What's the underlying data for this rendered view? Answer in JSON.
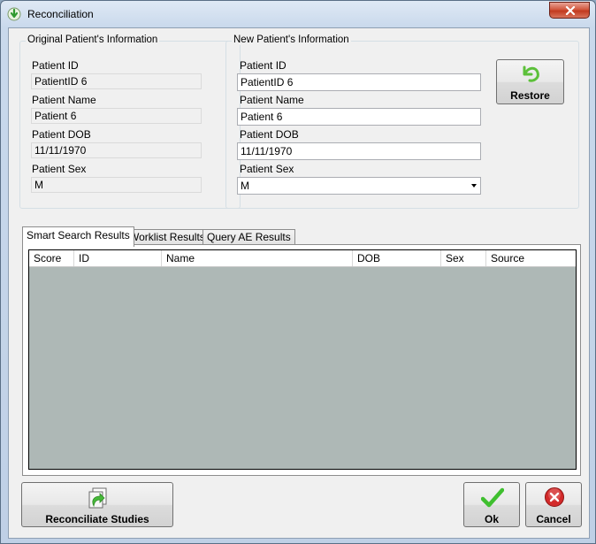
{
  "window": {
    "title": "Reconciliation",
    "close_glyph": "✕"
  },
  "original": {
    "group_title": "Original Patient's Information",
    "patient_id_label": "Patient ID",
    "patient_id": "PatientID 6",
    "patient_name_label": "Patient Name",
    "patient_name": "Patient 6",
    "patient_dob_label": "Patient DOB",
    "patient_dob": "11/11/1970",
    "patient_sex_label": "Patient Sex",
    "patient_sex": "M"
  },
  "new": {
    "group_title": "New Patient's Information",
    "patient_id_label": "Patient ID",
    "patient_id": "PatientID 6",
    "patient_name_label": "Patient Name",
    "patient_name": "Patient 6",
    "patient_dob_label": "Patient DOB",
    "patient_dob": "11/11/1970",
    "patient_sex_label": "Patient Sex",
    "patient_sex": "M",
    "restore_label": "Restore"
  },
  "tabs": [
    {
      "label": "Smart Search Results",
      "active": true
    },
    {
      "label": "Worklist Results",
      "active": false
    },
    {
      "label": "Query AE Results",
      "active": false
    }
  ],
  "grid": {
    "columns": [
      "Score",
      "ID",
      "Name",
      "DOB",
      "Sex",
      "Source"
    ],
    "rows": []
  },
  "buttons": {
    "reconciliate": "Reconciliate Studies",
    "ok": "Ok",
    "cancel": "Cancel"
  },
  "colors": {
    "grid_background": "#aeb8b6",
    "ok_check": "#3fbf2f",
    "cancel_circle": "#d32a2a",
    "restore_arrow": "#5cc03a"
  },
  "icons": {
    "app": "reconcile-arrow-icon",
    "restore": "undo-arrow-icon",
    "reconciliate": "reconcile-document-icon",
    "ok": "checkmark-icon",
    "cancel": "cancel-circle-icon",
    "dropdown": "chevron-down-icon"
  }
}
